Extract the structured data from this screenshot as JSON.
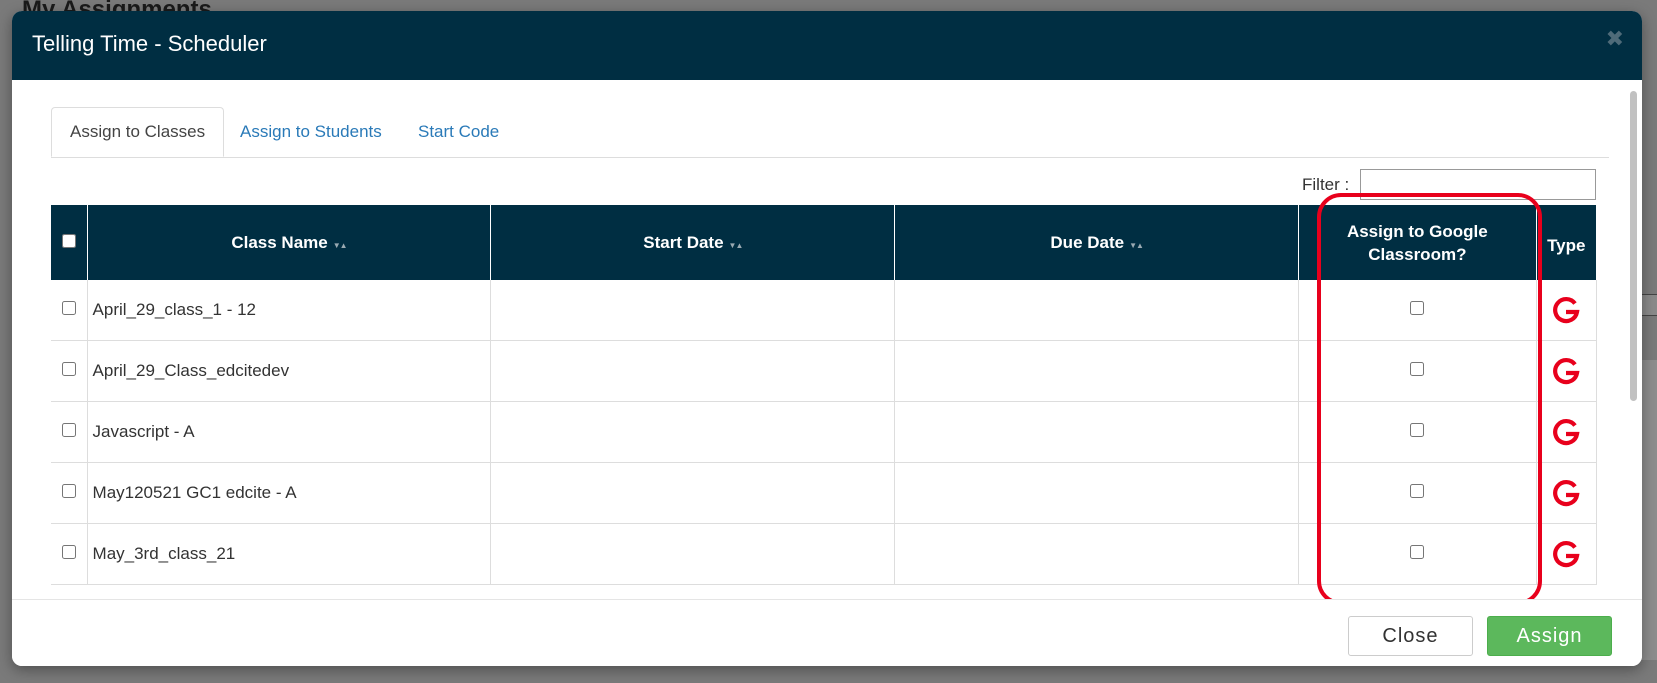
{
  "background": {
    "page_title": "My Assignments"
  },
  "modal": {
    "title": "Telling Time - Scheduler",
    "close_symbol": "✖"
  },
  "tabs": [
    {
      "label": "Assign to Classes",
      "active": true
    },
    {
      "label": "Assign to Students",
      "active": false
    },
    {
      "label": "Start Code",
      "active": false
    }
  ],
  "filter": {
    "label": "Filter :",
    "value": ""
  },
  "table": {
    "columns": {
      "class_name": "Class Name",
      "start_date": "Start Date",
      "due_date": "Due Date",
      "google": "Assign to Google Classroom?",
      "type": "Type"
    },
    "rows": [
      {
        "class_name": "April_29_class_1 - 12",
        "start_date": "",
        "due_date": "",
        "google_checked": false,
        "type_icon": "google-g-icon"
      },
      {
        "class_name": "April_29_Class_edcitedev",
        "start_date": "",
        "due_date": "",
        "google_checked": false,
        "type_icon": "google-g-icon"
      },
      {
        "class_name": "Javascript - A",
        "start_date": "",
        "due_date": "",
        "google_checked": false,
        "type_icon": "google-g-icon"
      },
      {
        "class_name": "May120521 GC1 edcite - A",
        "start_date": "",
        "due_date": "",
        "google_checked": false,
        "type_icon": "google-g-icon"
      },
      {
        "class_name": "May_3rd_class_21",
        "start_date": "",
        "due_date": "",
        "google_checked": false,
        "type_icon": "google-g-icon"
      }
    ]
  },
  "footer": {
    "close_label": "Close",
    "assign_label": "Assign"
  },
  "colors": {
    "header_bg": "#002e42",
    "link": "#2a7ab8",
    "assign_btn": "#5cb85c",
    "highlight": "#e8001c",
    "google_icon": "#e8001c"
  }
}
